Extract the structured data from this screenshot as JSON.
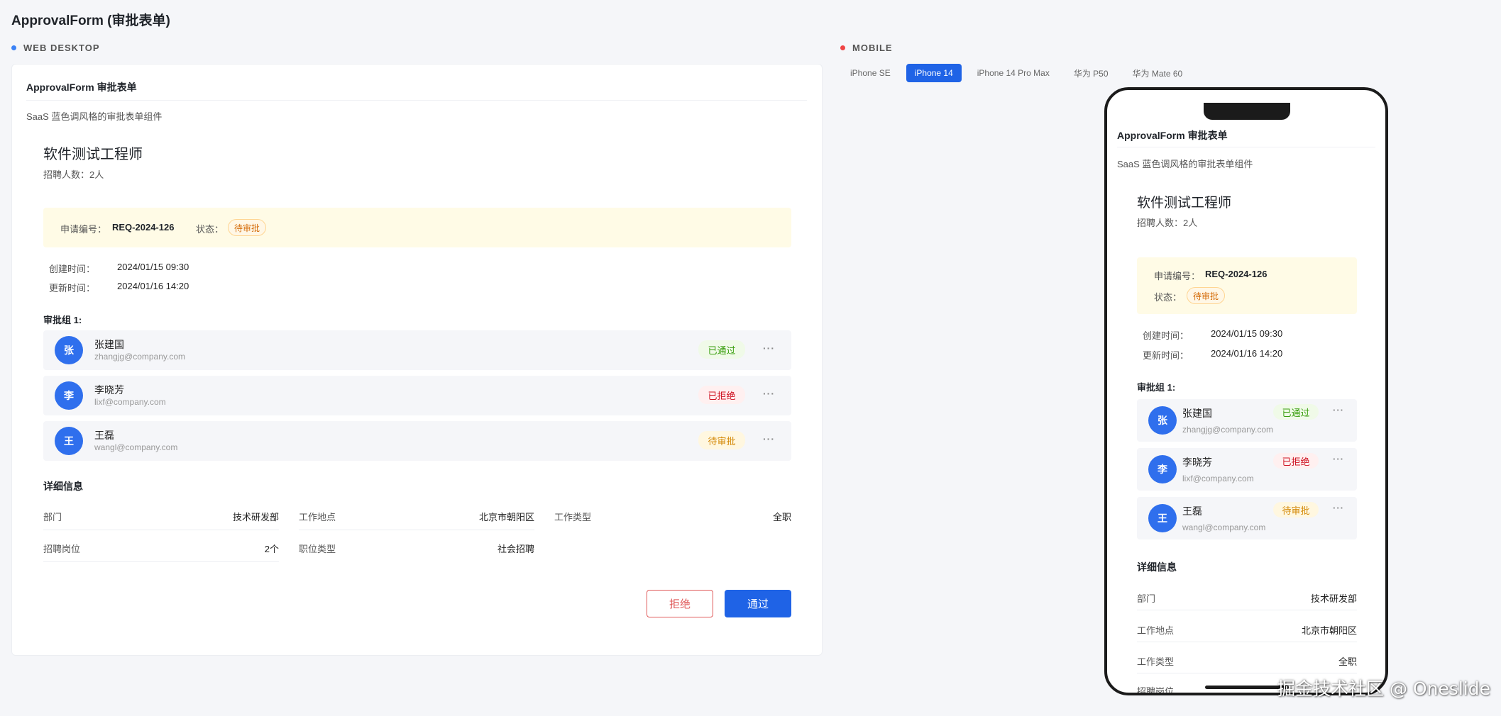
{
  "page_title": "ApprovalForm (审批表单)",
  "sections": {
    "web": "WEB DESKTOP",
    "mobile": "MOBILE"
  },
  "component": {
    "title": "ApprovalForm 审批表单",
    "description": "SaaS 蓝色调风格的审批表单组件"
  },
  "job": {
    "title": "软件测试工程师",
    "headcount": "招聘人数：2人"
  },
  "info": {
    "req_label": "申请编号：",
    "req_value": "REQ-2024-126",
    "status_label": "状态：",
    "status_value": "待审批"
  },
  "times": {
    "created_label": "创建时间：",
    "created_value": "2024/01/15 09:30",
    "updated_label": "更新时间：",
    "updated_value": "2024/01/16 14:20"
  },
  "group": {
    "title": "审批组 1:",
    "approvers": [
      {
        "avatar": "张",
        "name": "张建国",
        "email": "zhangjg@company.com",
        "status": "已通过",
        "status_type": "ok"
      },
      {
        "avatar": "李",
        "name": "李晓芳",
        "email": "lixf@company.com",
        "status": "已拒绝",
        "status_type": "rej"
      },
      {
        "avatar": "王",
        "name": "王磊",
        "email": "wangl@company.com",
        "status": "待审批",
        "status_type": "wait"
      }
    ]
  },
  "details": {
    "title": "详细信息",
    "items": [
      {
        "label": "部门",
        "value": "技术研发部"
      },
      {
        "label": "工作地点",
        "value": "北京市朝阳区"
      },
      {
        "label": "工作类型",
        "value": "全职"
      },
      {
        "label": "招聘岗位",
        "value": "2个"
      },
      {
        "label": "职位类型",
        "value": "社会招聘"
      }
    ]
  },
  "buttons": {
    "reject": "拒绝",
    "approve": "通过"
  },
  "more_glyph": "···",
  "device_tabs": [
    "iPhone SE",
    "iPhone 14",
    "iPhone 14 Pro Max",
    "华为 P50",
    "华为 Mate 60"
  ],
  "active_tab_index": 1,
  "watermark": "掘金技术社区 @ Oneslide",
  "colors": {
    "accent": "#1f63e6",
    "avatar": "#2f6fed",
    "reject": "#e05a5a",
    "info_bg": "#fffbe6"
  }
}
